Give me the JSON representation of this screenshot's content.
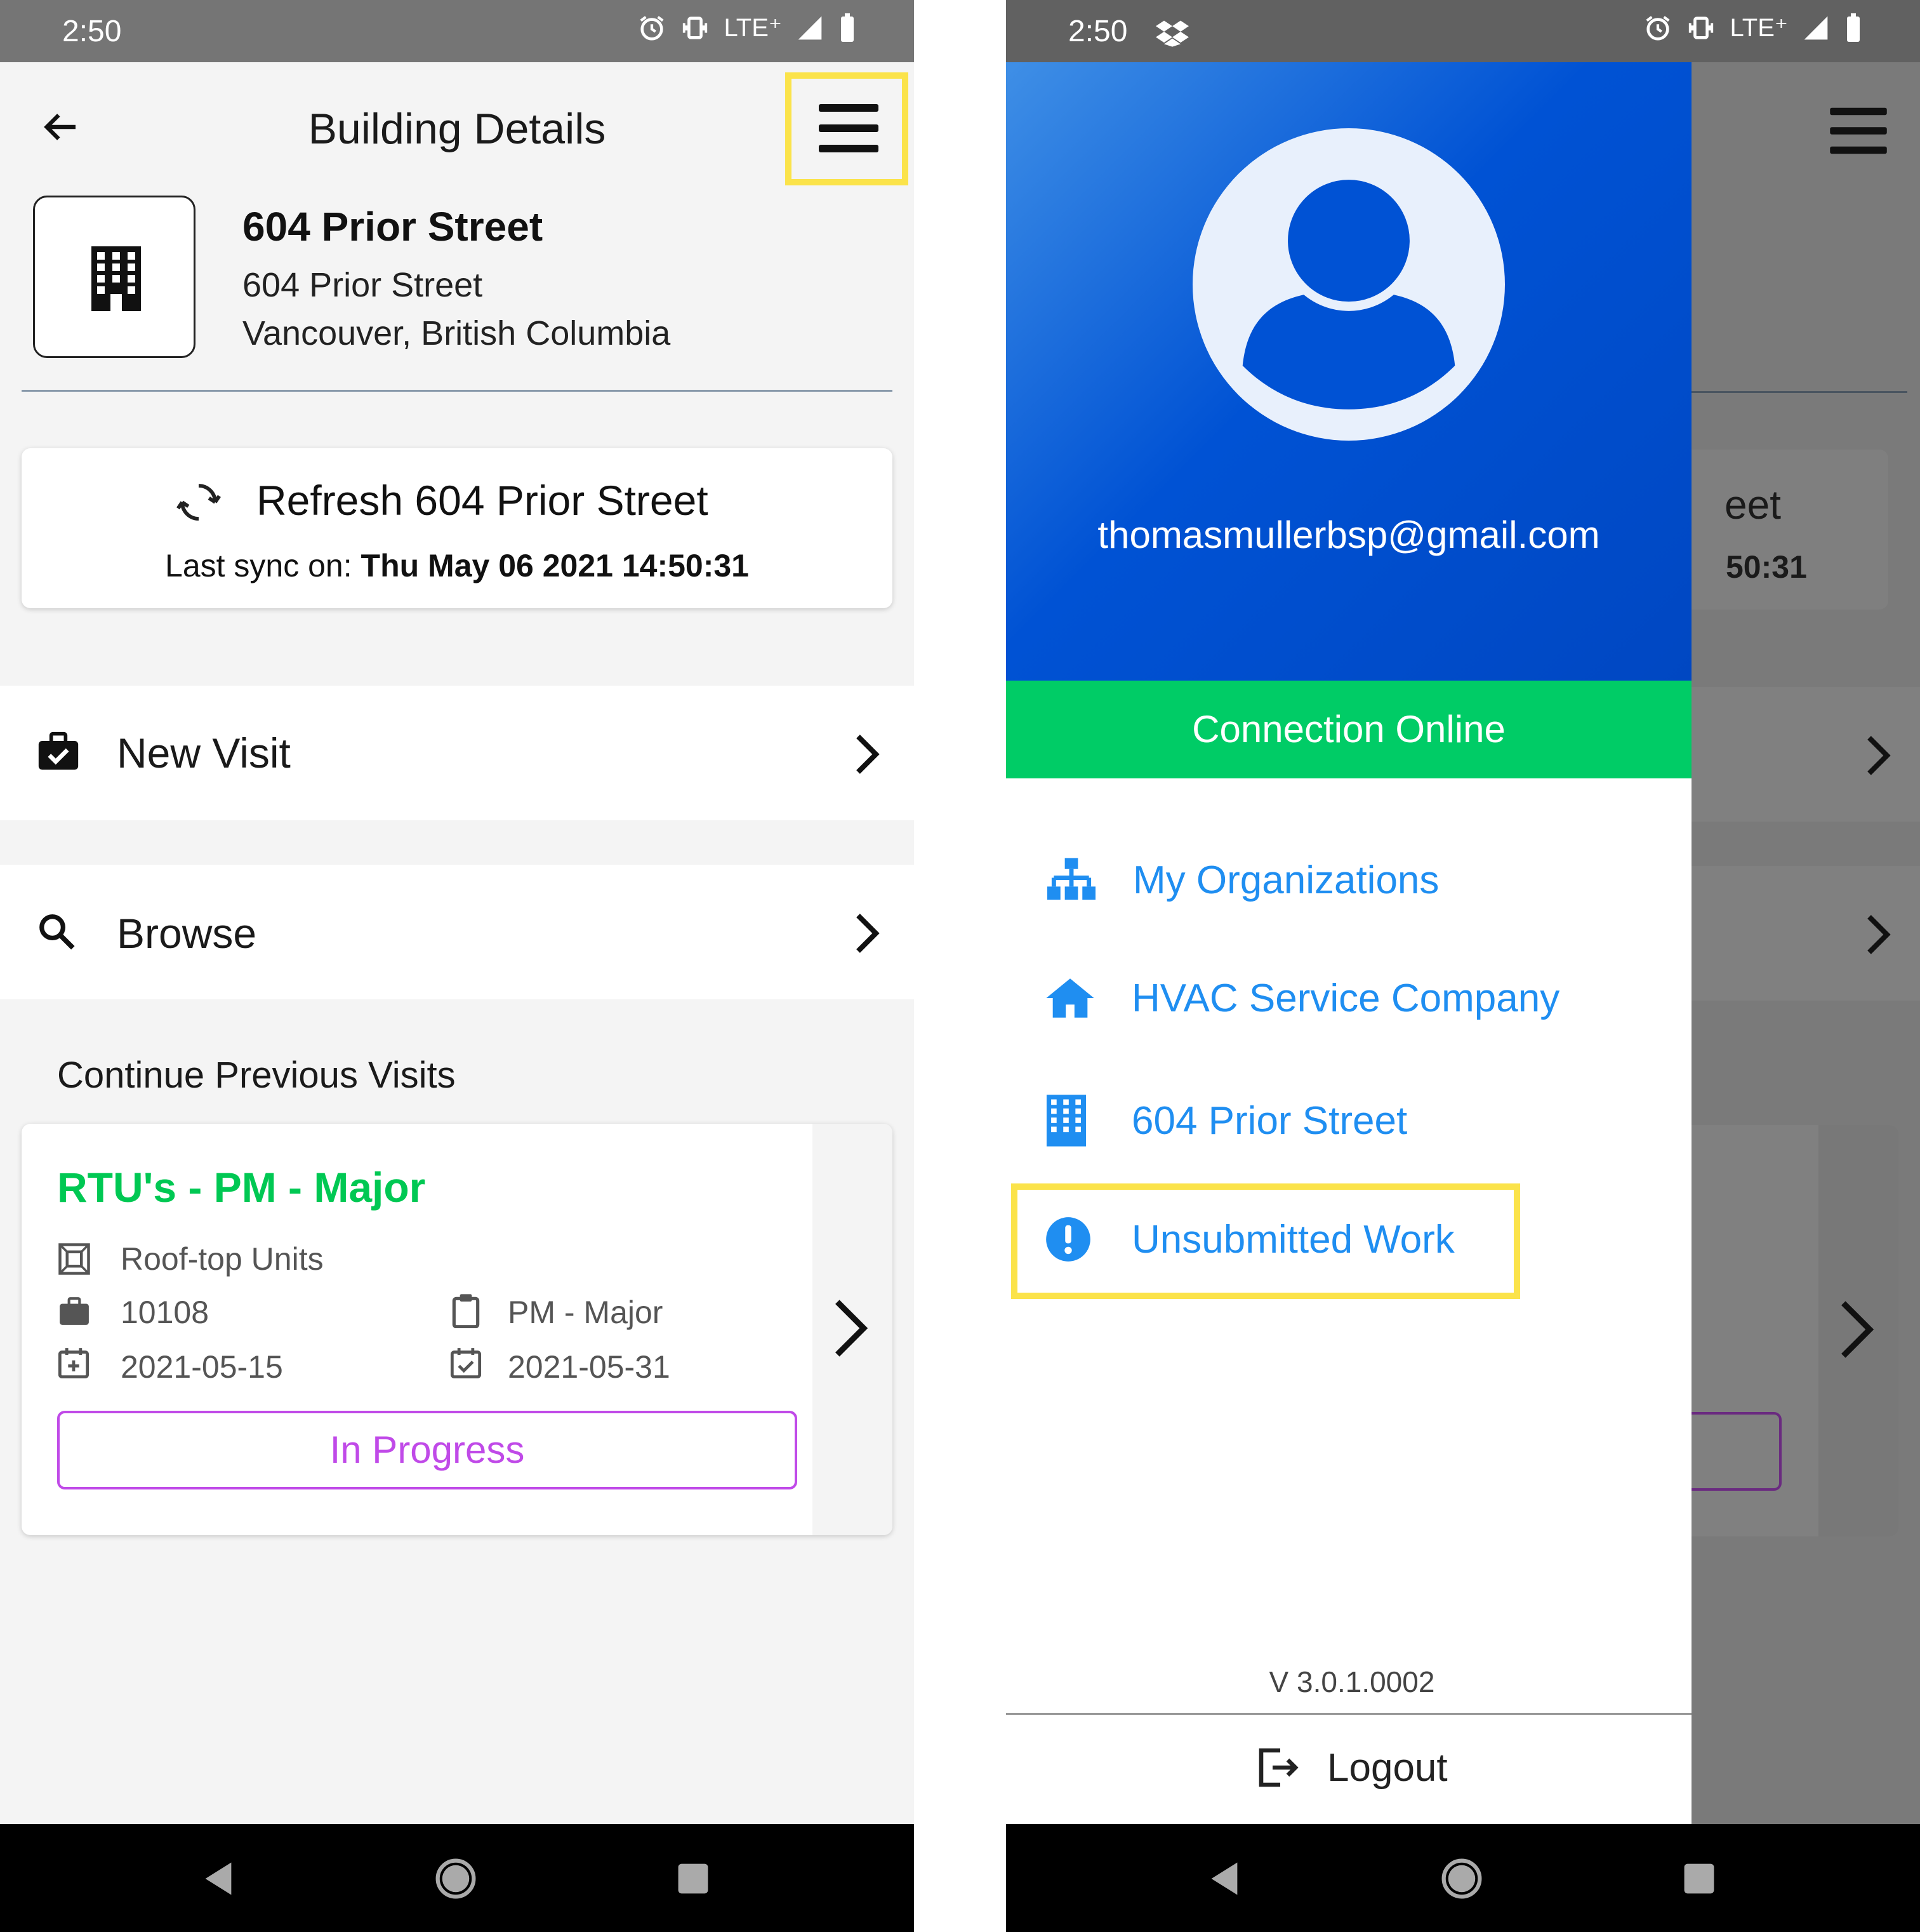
{
  "left_screen": {
    "status": {
      "time": "2:50",
      "network": "LTE⁺"
    },
    "header": {
      "title": "Building Details"
    },
    "building": {
      "name": "604 Prior Street",
      "address_line1": "604 Prior Street",
      "address_line2": "Vancouver, British Columbia"
    },
    "refresh": {
      "label": "Refresh 604 Prior Street",
      "sync_prefix": "Last sync on:",
      "sync_value": "Thu May 06 2021 14:50:31"
    },
    "menu": {
      "new_visit": "New Visit",
      "browse": "Browse"
    },
    "previous": {
      "heading": "Continue Previous Visits",
      "visit": {
        "title": "RTU's - PM - Major",
        "asset": "Roof-top Units",
        "number": "10108",
        "type": "PM - Major",
        "start_date": "2021-05-15",
        "end_date": "2021-05-31",
        "status": "In Progress"
      }
    }
  },
  "right_screen": {
    "status": {
      "time": "2:50",
      "network": "LTE⁺"
    },
    "drawer": {
      "email": "thomasmullerbsp@gmail.com",
      "connection": "Connection Online",
      "items": [
        {
          "label": "My Organizations",
          "icon": "sitemap-icon"
        },
        {
          "label": "HVAC Service Company",
          "icon": "home-icon"
        },
        {
          "label": "604 Prior Street",
          "icon": "building-icon"
        },
        {
          "label": "Unsubmitted Work",
          "icon": "exclamation-circle-icon"
        }
      ],
      "version": "V 3.0.1.0002",
      "logout": "Logout"
    },
    "background_peek": {
      "refresh_fragment": "eet",
      "sync_fragment": "50:31"
    }
  },
  "colors": {
    "highlight": "#fbe34a",
    "drawer_blue": "#0052d4",
    "online_green": "#00cc66",
    "link_blue": "#1f8ef1",
    "visit_green": "#00c853",
    "status_purple": "#c04ae8"
  }
}
